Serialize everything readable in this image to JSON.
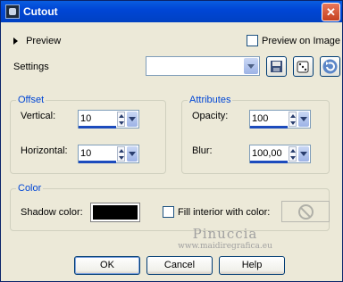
{
  "window": {
    "title": "Cutout",
    "close_glyph": "✕"
  },
  "preview": {
    "toggle_label": "Preview",
    "on_image_label": "Preview on Image",
    "on_image_checked": false
  },
  "settings": {
    "label": "Settings",
    "value": ""
  },
  "offset": {
    "legend": "Offset",
    "vertical_label": "Vertical:",
    "vertical_value": "10",
    "horizontal_label": "Horizontal:",
    "horizontal_value": "10"
  },
  "attributes": {
    "legend": "Attributes",
    "opacity_label": "Opacity:",
    "opacity_value": "100",
    "blur_label": "Blur:",
    "blur_value": "100,00"
  },
  "color": {
    "legend": "Color",
    "shadow_label": "Shadow color:",
    "shadow_color": "#000000",
    "fill_label": "Fill interior with color:",
    "fill_checked": false
  },
  "watermark": {
    "name": "Pinuccia",
    "url": "www.maidiregrafica.eu"
  },
  "buttons": {
    "ok": "OK",
    "cancel": "Cancel",
    "help": "Help"
  }
}
